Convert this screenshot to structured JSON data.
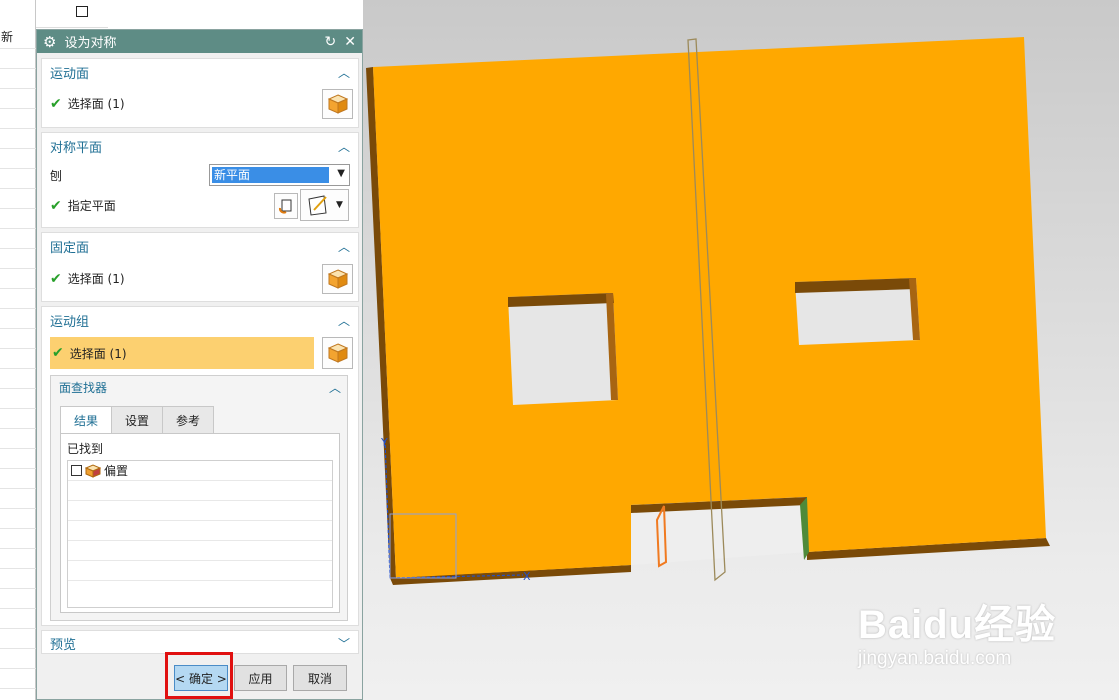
{
  "left_panel": {
    "header_text": "新"
  },
  "dialog": {
    "title": "设为对称",
    "groups": {
      "motion_face": {
        "title": "运动面",
        "row_label": "选择面 (1)"
      },
      "symmetry_plane": {
        "title": "对称平面",
        "create_label": "刨",
        "create_value": "新平面",
        "specify_label": "指定平面"
      },
      "fixed_face": {
        "title": "固定面",
        "row_label": "选择面 (1)"
      },
      "motion_group": {
        "title": "运动组",
        "row_label": "选择面 (1)",
        "face_finder": {
          "title": "面查找器",
          "tabs": [
            "结果",
            "设置",
            "参考"
          ],
          "found_label": "已找到",
          "items": [
            {
              "label": "偏置"
            }
          ]
        }
      },
      "preview": {
        "title": "预览"
      }
    },
    "buttons": {
      "ok": "< 确定 >",
      "apply": "应用",
      "cancel": "取消"
    }
  },
  "watermark": {
    "brand": "Baidu经验",
    "url": "jingyan.baidu.com"
  },
  "colors": {
    "titlebar": "#5e8c85",
    "part": "#ffa800",
    "accent": "#1f6f94",
    "highlight": "#fcd070"
  }
}
